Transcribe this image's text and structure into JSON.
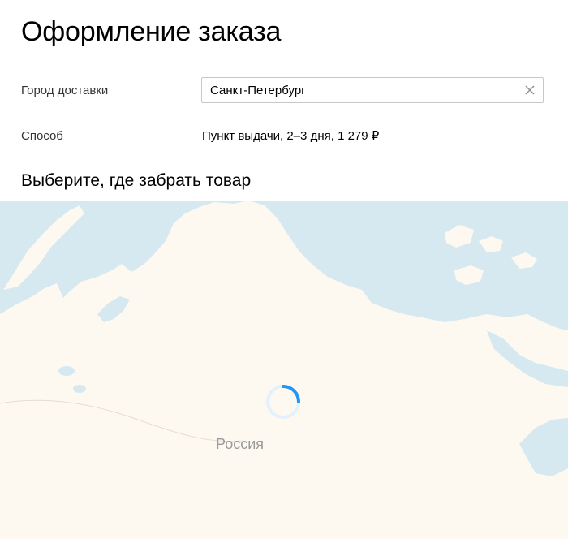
{
  "checkout": {
    "title": "Оформление заказа",
    "city_label": "Город доставки",
    "city_value": "Санкт-Петербург",
    "method_label": "Способ",
    "method_value": "Пункт выдачи, 2–3 дня, 1 279 ₽",
    "pickup_title": "Выберите, где забрать товар"
  },
  "map": {
    "country_label": "Россия",
    "state": "loading",
    "colors": {
      "water": "#d6e8f0",
      "land": "#fdf9f1",
      "spinner": "#2196f3",
      "spinner_track": "#e3f1fc"
    }
  },
  "icons": {
    "clear": "close-icon",
    "loading": "spinner-icon"
  }
}
